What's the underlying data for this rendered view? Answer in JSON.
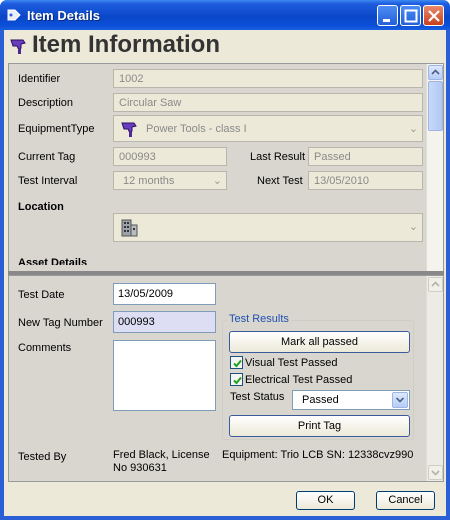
{
  "window": {
    "title": "Item Details"
  },
  "header": {
    "title": "Item Information"
  },
  "item": {
    "identifier_label": "Identifier",
    "identifier_value": "1002",
    "description_label": "Description",
    "description_value": "Circular Saw",
    "equipment_type_label": "EquipmentType",
    "equipment_type_value": "Power Tools - class I",
    "current_tag_label": "Current Tag",
    "current_tag_value": "000993",
    "last_result_label": "Last Result",
    "last_result_value": "Passed",
    "test_interval_label": "Test Interval",
    "test_interval_value": "12 months",
    "next_test_label": "Next Test",
    "next_test_value": "13/05/2010",
    "location_label": "Location",
    "location_value": "",
    "asset_details_label": "Asset Details"
  },
  "test": {
    "test_date_label": "Test Date",
    "test_date_value": "13/05/2009",
    "new_tag_label": "New Tag Number",
    "new_tag_value": "000993",
    "comments_label": "Comments",
    "comments_value": "",
    "tested_by_label": "Tested By",
    "tested_by_value_line1": "Fred Black, License",
    "tested_by_value_line2": "No 930631",
    "equipment_info": "Equipment: Trio LCB SN: 12338cvz990"
  },
  "test_results": {
    "legend": "Test Results",
    "mark_all_label": "Mark all passed",
    "visual_label": "Visual Test Passed",
    "visual_checked": true,
    "electrical_label": "Electrical Test Passed",
    "electrical_checked": true,
    "status_label": "Test Status",
    "status_value": "Passed",
    "print_tag_label": "Print Tag"
  },
  "footer": {
    "ok_label": "OK",
    "cancel_label": "Cancel"
  },
  "colors": {
    "titlebar": "#0a46c8",
    "accent": "#2050b0",
    "panel": "#d8d6cf"
  }
}
